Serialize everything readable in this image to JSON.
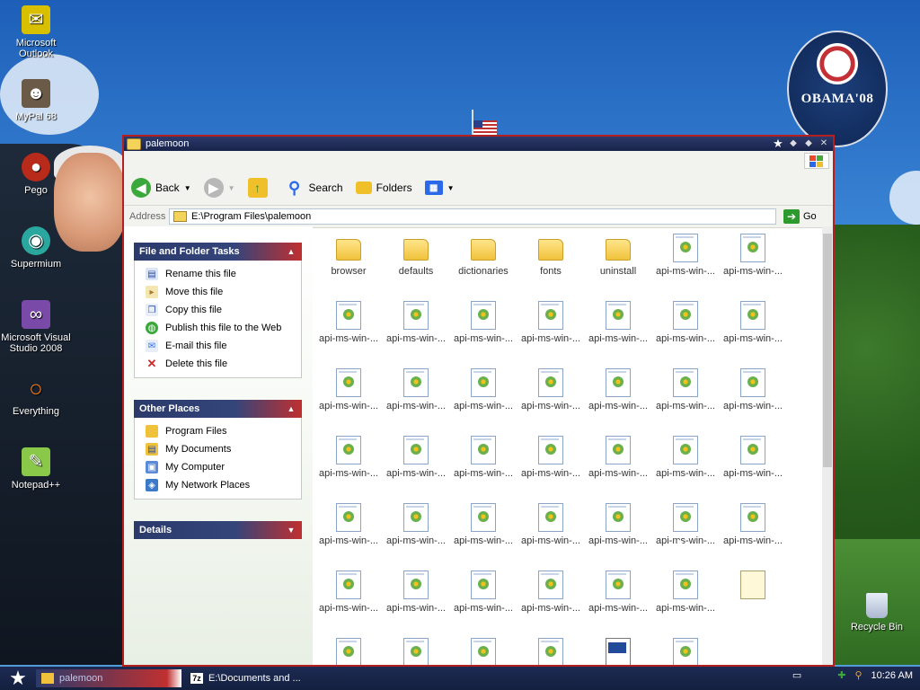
{
  "desktop": {
    "icons": [
      {
        "label": "Microsoft Outlook",
        "icon": "outlook-icon"
      },
      {
        "label": "MyPal 68",
        "icon": "mypal-icon"
      },
      {
        "label": "Pego",
        "icon": "pego-icon"
      },
      {
        "label": "Supermium",
        "icon": "supermium-icon"
      },
      {
        "label": "Microsoft Visual Studio 2008",
        "icon": "visual-studio-icon"
      },
      {
        "label": "Everything",
        "icon": "everything-icon"
      },
      {
        "label": "Notepad++",
        "icon": "notepadpp-icon"
      }
    ],
    "recycle_bin": "Recycle Bin",
    "campaign_logo": "OBAMA'08"
  },
  "window": {
    "title": "palemoon",
    "toolbar": {
      "back": "Back",
      "search": "Search",
      "folders": "Folders"
    },
    "address": {
      "label": "Address",
      "value": "E:\\Program Files\\palemoon",
      "go": "Go"
    },
    "tasks": {
      "file_folder_tasks": {
        "title": "File and Folder Tasks",
        "items": [
          "Rename this file",
          "Move this file",
          "Copy this file",
          "Publish this file to the Web",
          "E-mail this file",
          "Delete this file"
        ]
      },
      "other_places": {
        "title": "Other Places",
        "items": [
          "Program Files",
          "My Documents",
          "My Computer",
          "My Network Places"
        ]
      },
      "details": {
        "title": "Details"
      }
    },
    "files": [
      {
        "name": "browser",
        "type": "folder"
      },
      {
        "name": "defaults",
        "type": "folder"
      },
      {
        "name": "dictionaries",
        "type": "folder"
      },
      {
        "name": "fonts",
        "type": "folder"
      },
      {
        "name": "uninstall",
        "type": "folder"
      },
      {
        "name": "api-ms-win-...",
        "type": "dll"
      },
      {
        "name": "api-ms-win-...",
        "type": "dll"
      },
      {
        "name": "api-ms-win-...",
        "type": "dll"
      },
      {
        "name": "api-ms-win-...",
        "type": "dll"
      },
      {
        "name": "api-ms-win-...",
        "type": "dll"
      },
      {
        "name": "api-ms-win-...",
        "type": "dll"
      },
      {
        "name": "api-ms-win-...",
        "type": "dll"
      },
      {
        "name": "api-ms-win-...",
        "type": "dll"
      },
      {
        "name": "api-ms-win-...",
        "type": "dll"
      },
      {
        "name": "api-ms-win-...",
        "type": "dll"
      },
      {
        "name": "api-ms-win-...",
        "type": "dll"
      },
      {
        "name": "api-ms-win-...",
        "type": "dll"
      },
      {
        "name": "api-ms-win-...",
        "type": "dll"
      },
      {
        "name": "api-ms-win-...",
        "type": "dll"
      },
      {
        "name": "api-ms-win-...",
        "type": "dll"
      },
      {
        "name": "api-ms-win-...",
        "type": "dll"
      },
      {
        "name": "api-ms-win-...",
        "type": "dll"
      },
      {
        "name": "api-ms-win-...",
        "type": "dll"
      },
      {
        "name": "api-ms-win-...",
        "type": "dll"
      },
      {
        "name": "api-ms-win-...",
        "type": "dll"
      },
      {
        "name": "api-ms-win-...",
        "type": "dll"
      },
      {
        "name": "api-ms-win-...",
        "type": "dll"
      },
      {
        "name": "api-ms-win-...",
        "type": "dll"
      },
      {
        "name": "api-ms-win-...",
        "type": "dll"
      },
      {
        "name": "api-ms-win-...",
        "type": "dll"
      },
      {
        "name": "api-ms-win-...",
        "type": "dll"
      },
      {
        "name": "api-ms-win-...",
        "type": "dll"
      },
      {
        "name": "api-ms-win-...",
        "type": "dll"
      },
      {
        "name": "api-ms-win-...",
        "type": "dll"
      },
      {
        "name": "api-ms-win-...",
        "type": "dll"
      },
      {
        "name": "api-ms-win-...",
        "type": "dll"
      },
      {
        "name": "api-ms-win-...",
        "type": "dll"
      },
      {
        "name": "api-ms-win-...",
        "type": "dll"
      },
      {
        "name": "api-ms-win-...",
        "type": "dll"
      },
      {
        "name": "api-ms-win-...",
        "type": "dll"
      },
      {
        "name": "api-ms-win-...",
        "type": "dll"
      },
      {
        "name": "",
        "type": "txt"
      },
      {
        "name": "",
        "type": "dll"
      },
      {
        "name": "",
        "type": "dll"
      },
      {
        "name": "",
        "type": "dll"
      },
      {
        "name": "",
        "type": "dll"
      },
      {
        "name": "",
        "type": "win"
      },
      {
        "name": "",
        "type": "dll"
      }
    ]
  },
  "taskbar": {
    "buttons": [
      {
        "label": "palemoon",
        "active": true
      },
      {
        "label": "E:\\Documents and ...",
        "active": false
      }
    ],
    "clock": "10:26 AM"
  },
  "colors": {
    "titlebar": "#2b3a6b",
    "accent_red": "#c03030",
    "taskbar": "#1d2a52"
  }
}
